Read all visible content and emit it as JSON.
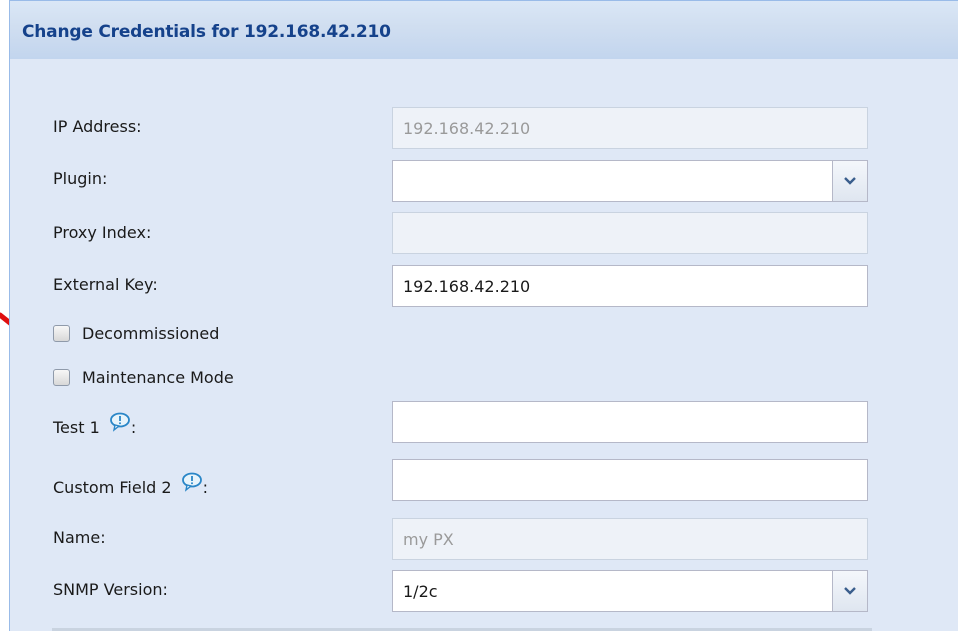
{
  "panel": {
    "title": "Change Credentials for 192.168.42.210"
  },
  "form": {
    "ip_address": {
      "label": "IP Address:",
      "value": "192.168.42.210",
      "disabled": true
    },
    "plugin": {
      "label": "Plugin:",
      "value": ""
    },
    "proxy_index": {
      "label": "Proxy Index:",
      "value": "",
      "disabled": true
    },
    "external_key": {
      "label": "External Key:",
      "value": "192.168.42.210"
    },
    "decommissioned": {
      "label": "Decommissioned",
      "checked": false
    },
    "maintenance_mode": {
      "label": "Maintenance Mode",
      "checked": false
    },
    "test1": {
      "label": "Test 1",
      "suffix": ":",
      "value": "",
      "help_icon": "speech-bubble-icon"
    },
    "custom_field2": {
      "label": "Custom Field 2",
      "suffix": ":",
      "value": "",
      "help_icon": "speech-bubble-icon"
    },
    "name": {
      "label": "Name:",
      "value": "my PX",
      "disabled": true
    },
    "snmp_version": {
      "label": "SNMP Version:",
      "value": "1/2c"
    }
  },
  "annotation": {
    "arrow_color": "#e01010"
  },
  "colors": {
    "header_title": "#15428b",
    "panel_bg": "#dfe8f6",
    "border": "#99bbe8"
  }
}
